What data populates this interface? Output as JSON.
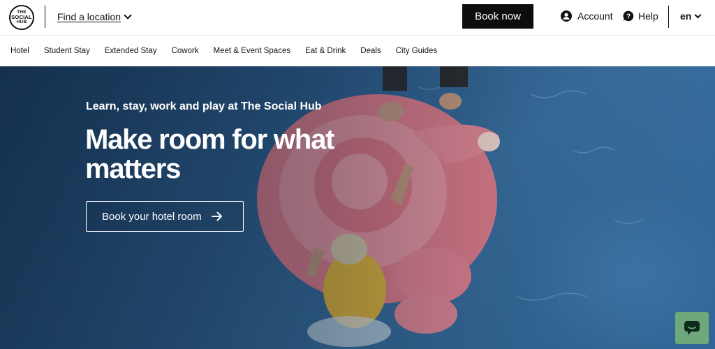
{
  "brand": {
    "logo_lines": [
      "THE",
      "SOCIAL",
      "HUB"
    ]
  },
  "header": {
    "find_location": "Find a location",
    "book_now": "Book now",
    "account": "Account",
    "help": "Help",
    "language": "en"
  },
  "nav": {
    "items": [
      "Hotel",
      "Student Stay",
      "Extended Stay",
      "Cowork",
      "Meet & Event Spaces",
      "Eat & Drink",
      "Deals",
      "City Guides"
    ]
  },
  "hero": {
    "eyebrow": "Learn, stay, work and play at The Social Hub",
    "headline": "Make room for what matters",
    "cta": "Book your hotel room"
  },
  "colors": {
    "primary": "#0d0d0d",
    "chat_widget": "#6fa97b",
    "pool_blue": "#2d5c8c",
    "float_pink": "#e8838f"
  },
  "icons": {
    "account": "user-circle-icon",
    "help": "chat-question-icon",
    "cta_arrow": "arrow-right-icon",
    "chat": "chat-bubble-icon"
  }
}
